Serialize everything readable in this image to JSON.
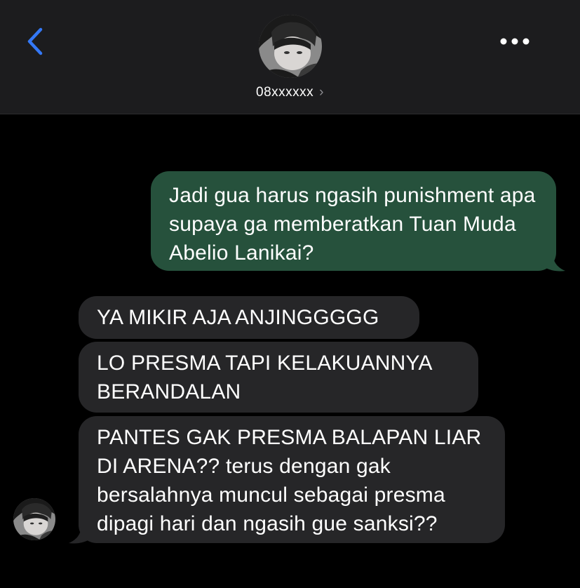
{
  "header": {
    "contact_name": "08xxxxxx",
    "chevron": "›",
    "back_icon": "chevron-left-icon",
    "more_icon": "ellipsis-icon",
    "accent_color": "#3478f6"
  },
  "messages": [
    {
      "direction": "outgoing",
      "text": "Jadi gua harus ngasih punishment apa supaya ga memberatkan Tuan Muda Abelio Lanikai?"
    },
    {
      "direction": "incoming",
      "text": "YA MIKIR AJA ANJINGGGGG"
    },
    {
      "direction": "incoming",
      "text": "LO PRESMA TAPI KELAKUANNYA BERANDALAN"
    },
    {
      "direction": "incoming",
      "text": "PANTES GAK PRESMA BALAPAN LIAR DI ARENA?? terus dengan gak bersalahnya muncul sebagai presma dipagi hari dan ngasih gue sanksi??"
    }
  ],
  "colors": {
    "outgoing_bubble": "#26513c",
    "incoming_bubble": "#262628",
    "background": "#000000",
    "header_bg": "#1c1c1e"
  }
}
